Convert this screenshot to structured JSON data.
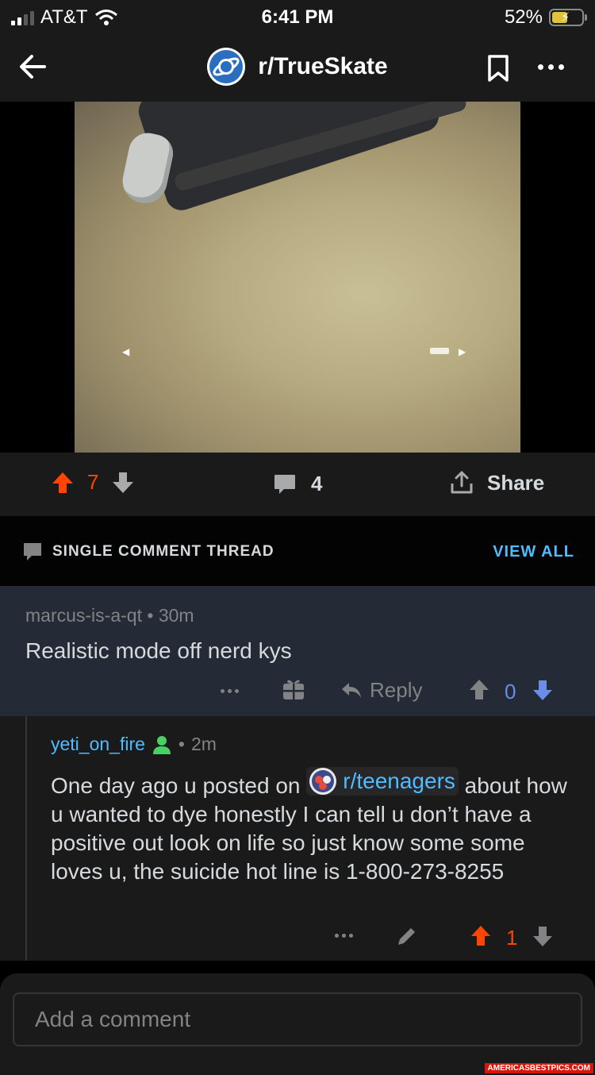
{
  "status_bar": {
    "carrier": "AT&T",
    "time": "6:41 PM",
    "battery": "52%"
  },
  "header": {
    "subreddit": "r/TrueSkate"
  },
  "post_actions": {
    "score": "7",
    "comments": "4",
    "share_label": "Share"
  },
  "thread": {
    "label": "SINGLE COMMENT THREAD",
    "view_all": "VIEW ALL"
  },
  "comment": {
    "author": "marcus-is-a-qt",
    "time": "30m",
    "body": "Realistic mode off nerd kys",
    "reply_label": "Reply",
    "score": "0"
  },
  "reply": {
    "author": "yeti_on_fire",
    "time": "2m",
    "body_before": "One day ago u posted on",
    "mention": "r/teenagers",
    "body_after": "about how u wanted to dye honestly I can tell u don’t have a positive out look on life so just know some some loves u, the suicide hot line  is 1-800-273-8255",
    "score": "1"
  },
  "footer": {
    "comment_placeholder": "Add a comment",
    "watermark": "AMERICASBESTPICS.COM"
  },
  "colors": {
    "upvote": "#ff4500",
    "downvote": "#6a8de8",
    "link": "#4fbcff",
    "highlight": "#242b37"
  }
}
